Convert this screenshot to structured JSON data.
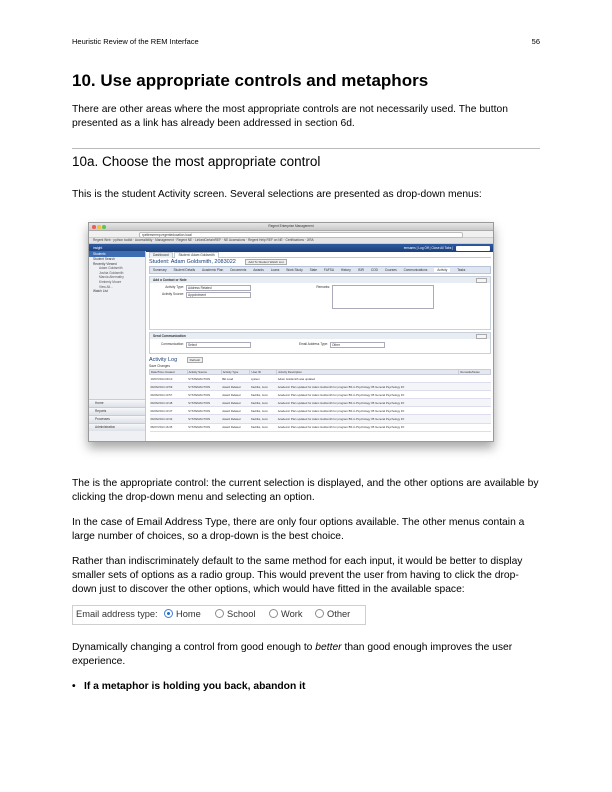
{
  "header": {
    "left": "Heuristic Review of the REM Interface",
    "page_number": "56"
  },
  "section_title": "10. Use appropriate controls and metaphors",
  "intro_paragraph": "There are other areas where the most appropriate controls are not necessarily used. The button presented as a link has already been addressed in section 6d.",
  "subsection_title": "10a. Choose the most appropriate control",
  "lead_paragraph": "This is the student Activity screen. Several selections are presented as drop-down menus:",
  "screenshot": {
    "window_title": "Regent Enterprise Management",
    "url": "rpeliemmrmp.regentedu­cation.local",
    "bookmarks": "Regent Web  ·  python toolkit  ·  Accessibility  ·  Management  ·  Regent NE  ·  LinkedCertainREF  ·  NE Accessions  ·  Regent Help REF on NE  ·  Certifications  ·  JIRA",
    "app_name": "insight",
    "app_user": "emsams  |  Log Off  |  Close All Tabs  |",
    "sidebar_header": "Students",
    "sidebar_items": [
      "Student Search",
      "Recently Viewed"
    ],
    "sidebar_sub_items": [
      "Adam Goldsmith",
      "Joshia Goldsmith",
      "Marcia Abernathy",
      "Kimberly Moore",
      "View All..."
    ],
    "sidebar_watch": "Watch List",
    "sidebar_nav": [
      "Home",
      "Reports",
      "Processes",
      "Administration"
    ],
    "tabs": [
      "Dashboard",
      "Student: Adam Goldsmith"
    ],
    "student_name": "Student: Adam Goldsmith, 2083022",
    "add_watch": "Add To Student Watch List",
    "subtabs": [
      "Summary",
      "Student Details",
      "Academic Plan",
      "Documents",
      "Awards",
      "Loans",
      "Work Study",
      "State",
      "FAFSA",
      "History",
      "ISIR",
      "COD",
      "Courses",
      "Communications",
      "Activity",
      "Tasks"
    ],
    "active_subtab": "Activity",
    "contact_panel": "Add a Contact or Note",
    "activity_type_label": "Activity Type:",
    "activity_type_value": "Address Related",
    "activity_source_label": "Activity Source:",
    "activity_source_value": "Appointment",
    "remarks_label": "Remarks:",
    "add_label": "Add",
    "comm_panel": "Send Communication",
    "communication_label": "Communication:",
    "communication_value": "Select",
    "email_type_label": "Email Address Type:",
    "email_type_value": "Other",
    "log_title": "Activity Log",
    "refresh": "Refresh",
    "save_changes": "Save Changes",
    "columns": [
      "Date/Time Created",
      "Activity Source",
      "Activity Type",
      "User ID",
      "Activity Description",
      "Remarks/Notes"
    ],
    "rows": [
      [
        "10/07/2014 09:10",
        "SYSTEMACTION",
        "Bkt Load",
        "system",
        "Adam Goldsmith was updated"
      ],
      [
        "09/26/2014 13:59",
        "SYSTEMACTION",
        "Award Related",
        "Kadriks, Jenn",
        "Academic Plan updated for Adam Goldsmith for program BS in Psychology #5 General Psychology FF"
      ],
      [
        "09/26/2014 13:57",
        "SYSTEMACTION",
        "Award Related",
        "Kadriks, Jenn",
        "Academic Plan updated for Adam Goldsmith for program BS in Psychology #5 General Psychology FF"
      ],
      [
        "09/26/2014 13:48",
        "SYSTEMACTION",
        "Award Related",
        "Kadriks, Jenn",
        "Academic Plan updated for Adam Goldsmith for program BS in Psychology #5 General Psychology FF"
      ],
      [
        "09/26/2014 13:47",
        "SYSTEMACTION",
        "Award Related",
        "Kadriks, Jenn",
        "Academic Plan updated for Adam Goldsmith for program BS in Psychology #5 General Psychology FF"
      ],
      [
        "09/26/2014 13:32",
        "SYSTEMACTION",
        "Award Related",
        "Kadriks, Jenn",
        "Academic Plan updated for Adam Goldsmith for program BS in Psychology #5 General Psychology FF"
      ],
      [
        "08/27/2014 16:35",
        "SYSTEMACTION",
        "Award Related",
        "Kadriks, Jenn",
        "Academic Plan updated for Adam Goldsmith for program BS in Psychology #5 General Psychology FF"
      ]
    ]
  },
  "para_appropriate": "The is the appropriate control: the current selection is displayed, and the other options are available by clicking the drop-down menu and selecting an option.",
  "para_email": "In the case of Email Address Type, there are only four options available. The other menus contain a large number of choices, so a drop-down is the best choice.",
  "para_radio": "Rather than indiscriminately default to the same method for each input, it would be better to display smaller sets of options as a radio group. This would prevent the user from having to click the drop-down just to discover the other options, which would have fitted in the available space:",
  "radio_group": {
    "label": "Email address type:",
    "options": [
      "Home",
      "School",
      "Work",
      "Other"
    ],
    "selected": "Home"
  },
  "para_dynamic_before": "Dynamically changing a control from good enough to ",
  "para_dynamic_em": "better",
  "para_dynamic_after": " than good enough improves the user experience.",
  "bullet_text": "If a metaphor is holding you back, abandon it",
  "colors": {
    "radio_accent": "#2a6cc9",
    "app_bar": "#1b3f7a"
  }
}
